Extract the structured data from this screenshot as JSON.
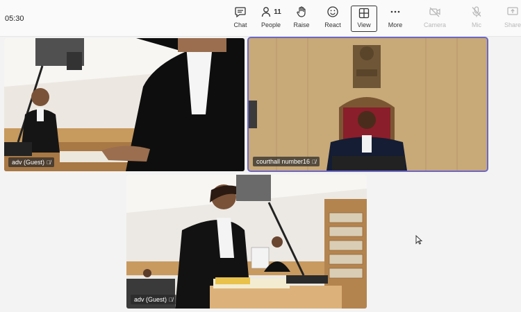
{
  "meeting": {
    "timer": "05:30"
  },
  "toolbar": {
    "chat": "Chat",
    "people": "People",
    "people_count": "11",
    "raise": "Raise",
    "react": "React",
    "view": "View",
    "more": "More",
    "camera": "Camera",
    "mic": "Mic",
    "share": "Share"
  },
  "participants": [
    {
      "name": "adv (Guest)",
      "muted": true
    },
    {
      "name": "courthall number16",
      "muted": true
    },
    {
      "name": "adv (Guest)",
      "muted": true
    }
  ]
}
